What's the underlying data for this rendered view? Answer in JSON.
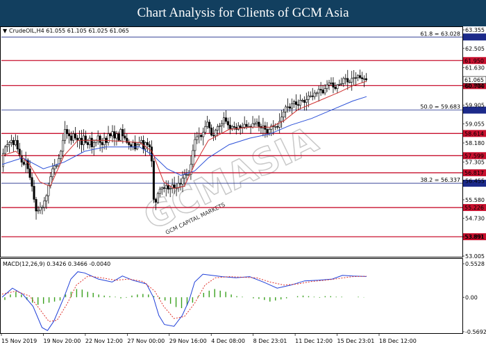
{
  "header": {
    "title": "Chart Analysis for Clients of GCM Asia"
  },
  "instrument_label": "CrudeOIL,H4  61.055 61.105 61.025 61.065",
  "watermark": {
    "main": "GCMASIA",
    "sub": "GCM CAPITAL MARKETS"
  },
  "colors": {
    "banner": "#123f5f",
    "support_resistance": "#c8102e",
    "fibo": "#1c2a8a",
    "ma_fast": "#d0302f",
    "ma_slow": "#2b50d8",
    "macd_line": "#1f3fd8",
    "macd_signal": "#e0302a",
    "macd_hist": "#3aa11e"
  },
  "chart_data": {
    "type": "line",
    "title": "",
    "instrument": "CrudeOIL",
    "timeframe": "H4",
    "x_labels": [
      "15 Nov 2019",
      "19 Nov 20:00",
      "22 Nov 12:00",
      "27 Nov 00:00",
      "29 Nov 16:00",
      "4 Dec 08:00",
      "8 Dec 23:01",
      "11 Dec 12:00",
      "15 Dec 23:01",
      "18 Dec 12:00"
    ],
    "price_axis": {
      "ticks": [
        "63.355",
        "62.505",
        "61.630",
        "60.780",
        "59.905",
        "59.055",
        "58.180",
        "57.305",
        "56.455",
        "55.580",
        "54.730",
        "53.891",
        "53.005"
      ],
      "ylim": [
        53.005,
        63.355
      ]
    },
    "levels": {
      "resistance_support": [
        {
          "value": 61.95,
          "label": "61.950"
        },
        {
          "value": 60.804,
          "label": "60.804"
        },
        {
          "value": 58.614,
          "label": "58.614"
        },
        {
          "value": 57.599,
          "label": "57.599"
        },
        {
          "value": 56.817,
          "label": "56.817"
        },
        {
          "value": 55.226,
          "label": "55.226"
        },
        {
          "value": 53.891,
          "label": "53.891"
        }
      ],
      "fibonacci": [
        {
          "value": 63.028,
          "label": "61.8 = 63.028"
        },
        {
          "value": 59.683,
          "label": "50.0 = 59.683"
        },
        {
          "value": 56.337,
          "label": "38.2 = 56.337"
        }
      ]
    },
    "current_price": {
      "value": 61.065,
      "label": "61.065"
    },
    "price_path": [
      [
        0,
        57.1
      ],
      [
        3,
        57.7
      ],
      [
        6,
        58.0
      ],
      [
        9,
        58.1
      ],
      [
        12,
        58.2
      ],
      [
        15,
        58.3
      ],
      [
        18,
        58.1
      ],
      [
        21,
        58.3
      ],
      [
        24,
        57.9
      ],
      [
        27,
        57.6
      ],
      [
        30,
        57.3
      ],
      [
        33,
        57.2
      ],
      [
        36,
        57.4
      ],
      [
        39,
        57.0
      ],
      [
        42,
        56.6
      ],
      [
        45,
        56.2
      ],
      [
        48,
        55.6
      ],
      [
        50,
        55.1
      ],
      [
        53,
        55.0
      ],
      [
        56,
        55.3
      ],
      [
        59,
        55.1
      ],
      [
        62,
        55.5
      ],
      [
        65,
        55.6
      ],
      [
        68,
        56.1
      ],
      [
        71,
        56.5
      ],
      [
        74,
        56.9
      ],
      [
        77,
        57.2
      ],
      [
        80,
        57.0
      ],
      [
        83,
        57.4
      ],
      [
        86,
        57.6
      ],
      [
        88,
        58.0
      ],
      [
        90,
        58.3
      ],
      [
        93,
        58.8
      ],
      [
        96,
        58.6
      ],
      [
        99,
        58.5
      ],
      [
        102,
        58.3
      ],
      [
        105,
        58.6
      ],
      [
        108,
        58.4
      ],
      [
        111,
        58.3
      ],
      [
        114,
        58.4
      ],
      [
        117,
        58.1
      ],
      [
        120,
        58.5
      ],
      [
        123,
        58.2
      ],
      [
        126,
        58.1
      ],
      [
        129,
        58.4
      ],
      [
        132,
        58.0
      ],
      [
        135,
        58.2
      ],
      [
        138,
        58.3
      ],
      [
        141,
        58.5
      ],
      [
        144,
        58.2
      ],
      [
        147,
        58.1
      ],
      [
        150,
        58.4
      ],
      [
        153,
        58.2
      ],
      [
        156,
        58.6
      ],
      [
        159,
        58.5
      ],
      [
        162,
        58.7
      ],
      [
        165,
        58.4
      ],
      [
        168,
        58.6
      ],
      [
        171,
        58.3
      ],
      [
        174,
        58.8
      ],
      [
        177,
        58.5
      ],
      [
        180,
        58.4
      ],
      [
        183,
        58.2
      ],
      [
        186,
        58.1
      ],
      [
        189,
        58.0
      ],
      [
        192,
        58.2
      ],
      [
        195,
        57.9
      ],
      [
        198,
        58.1
      ],
      [
        201,
        58.2
      ],
      [
        204,
        58.3
      ],
      [
        207,
        57.9
      ],
      [
        210,
        58.2
      ],
      [
        213,
        58.1
      ],
      [
        216,
        58.0
      ],
      [
        218,
        57.9
      ],
      [
        220,
        56.8
      ],
      [
        222,
        55.6
      ],
      [
        224,
        55.3
      ],
      [
        227,
        55.8
      ],
      [
        230,
        56.0
      ],
      [
        233,
        56.2
      ],
      [
        236,
        56.0
      ],
      [
        239,
        56.3
      ],
      [
        242,
        56.1
      ],
      [
        245,
        56.0
      ],
      [
        248,
        56.3
      ],
      [
        251,
        56.2
      ],
      [
        254,
        56.0
      ],
      [
        257,
        56.4
      ],
      [
        260,
        56.2
      ],
      [
        263,
        56.5
      ],
      [
        266,
        56.7
      ],
      [
        269,
        56.8
      ],
      [
        272,
        56.6
      ],
      [
        275,
        57.0
      ],
      [
        278,
        57.6
      ],
      [
        281,
        58.3
      ],
      [
        284,
        58.4
      ],
      [
        287,
        58.6
      ],
      [
        290,
        58.4
      ],
      [
        293,
        58.6
      ],
      [
        296,
        58.8
      ],
      [
        299,
        59.2
      ],
      [
        302,
        59.0
      ],
      [
        305,
        58.6
      ],
      [
        308,
        58.4
      ],
      [
        311,
        58.7
      ],
      [
        314,
        58.9
      ],
      [
        317,
        59.0
      ],
      [
        320,
        58.9
      ],
      [
        323,
        59.4
      ],
      [
        326,
        59.2
      ],
      [
        329,
        59.1
      ],
      [
        332,
        58.8
      ],
      [
        335,
        58.9
      ],
      [
        338,
        59.0
      ],
      [
        341,
        58.7
      ],
      [
        344,
        59.0
      ],
      [
        347,
        58.9
      ],
      [
        350,
        58.8
      ],
      [
        353,
        59.1
      ],
      [
        356,
        58.9
      ],
      [
        359,
        59.0
      ],
      [
        362,
        58.8
      ],
      [
        365,
        59.1
      ],
      [
        368,
        59.0
      ],
      [
        371,
        59.2
      ],
      [
        374,
        59.0
      ],
      [
        377,
        58.8
      ],
      [
        380,
        59.0
      ],
      [
        383,
        58.9
      ],
      [
        386,
        58.6
      ],
      [
        389,
        58.7
      ],
      [
        392,
        59.0
      ],
      [
        395,
        58.9
      ],
      [
        398,
        59.0
      ],
      [
        401,
        58.8
      ],
      [
        404,
        59.1
      ],
      [
        407,
        59.3
      ],
      [
        410,
        59.5
      ],
      [
        413,
        59.8
      ],
      [
        416,
        59.9
      ],
      [
        419,
        59.7
      ],
      [
        422,
        59.9
      ],
      [
        425,
        60.1
      ],
      [
        428,
        60.0
      ],
      [
        431,
        59.8
      ],
      [
        434,
        60.1
      ],
      [
        437,
        60.2
      ],
      [
        440,
        60.0
      ],
      [
        443,
        60.1
      ],
      [
        446,
        60.3
      ],
      [
        449,
        60.4
      ],
      [
        452,
        60.2
      ],
      [
        455,
        60.5
      ],
      [
        458,
        60.4
      ],
      [
        461,
        60.6
      ],
      [
        464,
        60.7
      ],
      [
        467,
        60.4
      ],
      [
        470,
        60.6
      ],
      [
        473,
        60.8
      ],
      [
        476,
        60.9
      ],
      [
        479,
        61.0
      ],
      [
        482,
        60.8
      ],
      [
        485,
        60.6
      ],
      [
        488,
        60.8
      ],
      [
        491,
        60.9
      ],
      [
        494,
        60.8
      ],
      [
        497,
        61.1
      ],
      [
        500,
        61.2
      ],
      [
        503,
        61.0
      ],
      [
        506,
        60.9
      ],
      [
        509,
        61.1
      ],
      [
        512,
        61.2
      ],
      [
        515,
        61.1
      ],
      [
        518,
        61.3
      ],
      [
        521,
        61.2
      ],
      [
        524,
        61.1
      ],
      [
        527,
        61.15
      ],
      [
        530,
        61.065
      ]
    ],
    "ma_fast_path": [
      [
        0,
        57.6
      ],
      [
        20,
        57.8
      ],
      [
        40,
        57.2
      ],
      [
        55,
        56.4
      ],
      [
        70,
        56.2
      ],
      [
        90,
        57.6
      ],
      [
        110,
        58.3
      ],
      [
        150,
        58.3
      ],
      [
        200,
        58.2
      ],
      [
        218,
        57.8
      ],
      [
        235,
        56.4
      ],
      [
        250,
        56.1
      ],
      [
        265,
        56.2
      ],
      [
        280,
        57.2
      ],
      [
        300,
        58.3
      ],
      [
        330,
        58.8
      ],
      [
        360,
        58.9
      ],
      [
        390,
        58.9
      ],
      [
        410,
        59.2
      ],
      [
        430,
        59.7
      ],
      [
        460,
        60.1
      ],
      [
        490,
        60.5
      ],
      [
        510,
        60.8
      ],
      [
        530,
        61.0
      ]
    ],
    "ma_slow_path": [
      [
        0,
        57.2
      ],
      [
        30,
        57.5
      ],
      [
        60,
        57.0
      ],
      [
        90,
        57.3
      ],
      [
        120,
        57.8
      ],
      [
        150,
        58.0
      ],
      [
        200,
        58.0
      ],
      [
        220,
        57.6
      ],
      [
        240,
        57.0
      ],
      [
        260,
        56.7
      ],
      [
        280,
        56.9
      ],
      [
        300,
        57.5
      ],
      [
        330,
        58.1
      ],
      [
        360,
        58.4
      ],
      [
        390,
        58.6
      ],
      [
        420,
        59.0
      ],
      [
        450,
        59.3
      ],
      [
        480,
        59.7
      ],
      [
        510,
        60.1
      ],
      [
        530,
        60.3
      ]
    ],
    "macd": {
      "label": "MACD(12,26,9) 0.3426 0.3466 -0.0040",
      "ylim": [
        -0.5692,
        0.5528
      ],
      "ticks": [
        "0.5528",
        "0.00",
        "-0.5692"
      ],
      "macd_line": [
        [
          0,
          0.0
        ],
        [
          15,
          0.15
        ],
        [
          30,
          0.05
        ],
        [
          45,
          -0.15
        ],
        [
          58,
          -0.5
        ],
        [
          66,
          -0.55
        ],
        [
          75,
          -0.4
        ],
        [
          90,
          0.0
        ],
        [
          100,
          0.3
        ],
        [
          110,
          0.42
        ],
        [
          120,
          0.4
        ],
        [
          140,
          0.3
        ],
        [
          160,
          0.25
        ],
        [
          175,
          0.35
        ],
        [
          190,
          0.28
        ],
        [
          210,
          0.22
        ],
        [
          220,
          0.0
        ],
        [
          228,
          -0.3
        ],
        [
          236,
          -0.45
        ],
        [
          250,
          -0.48
        ],
        [
          262,
          -0.3
        ],
        [
          272,
          -0.05
        ],
        [
          280,
          0.25
        ],
        [
          292,
          0.38
        ],
        [
          305,
          0.36
        ],
        [
          320,
          0.34
        ],
        [
          340,
          0.32
        ],
        [
          360,
          0.34
        ],
        [
          380,
          0.25
        ],
        [
          400,
          0.15
        ],
        [
          420,
          0.2
        ],
        [
          440,
          0.27
        ],
        [
          460,
          0.28
        ],
        [
          480,
          0.3
        ],
        [
          495,
          0.36
        ],
        [
          510,
          0.35
        ],
        [
          530,
          0.3426
        ]
      ],
      "signal_line": [
        [
          0,
          0.05
        ],
        [
          20,
          0.1
        ],
        [
          40,
          0.02
        ],
        [
          55,
          -0.2
        ],
        [
          68,
          -0.4
        ],
        [
          80,
          -0.38
        ],
        [
          95,
          -0.1
        ],
        [
          108,
          0.2
        ],
        [
          125,
          0.35
        ],
        [
          145,
          0.32
        ],
        [
          165,
          0.28
        ],
        [
          185,
          0.3
        ],
        [
          205,
          0.26
        ],
        [
          222,
          0.1
        ],
        [
          235,
          -0.15
        ],
        [
          250,
          -0.35
        ],
        [
          265,
          -0.32
        ],
        [
          280,
          -0.1
        ],
        [
          295,
          0.2
        ],
        [
          310,
          0.32
        ],
        [
          330,
          0.34
        ],
        [
          350,
          0.33
        ],
        [
          370,
          0.32
        ],
        [
          390,
          0.25
        ],
        [
          410,
          0.2
        ],
        [
          430,
          0.22
        ],
        [
          450,
          0.26
        ],
        [
          470,
          0.28
        ],
        [
          490,
          0.31
        ],
        [
          510,
          0.34
        ],
        [
          530,
          0.3466
        ]
      ],
      "histogram": [
        -0.05,
        0.05,
        0.1,
        0.05,
        -0.05,
        -0.1,
        -0.14,
        -0.12,
        -0.1,
        -0.08,
        -0.06,
        0.05,
        0.1,
        0.15,
        0.14,
        0.1,
        0.08,
        0.05,
        0.03,
        0.02,
        0.01,
        -0.02,
        -0.01,
        0.03,
        0.05,
        0.06,
        0.05,
        0.02,
        -0.03,
        -0.06,
        -0.12,
        -0.18,
        -0.2,
        -0.15,
        -0.1,
        0.02,
        0.08,
        0.12,
        0.15,
        0.12,
        0.1,
        0.05,
        0.02,
        0.01,
        0.0,
        -0.02,
        -0.03,
        -0.05,
        -0.08,
        -0.06,
        -0.04,
        -0.02,
        0.0,
        0.02,
        0.03,
        0.02,
        0.01,
        -0.01,
        0.02,
        0.02,
        0.01,
        0.01,
        0.0,
        0.0,
        0.01,
        -0.004
      ]
    }
  }
}
